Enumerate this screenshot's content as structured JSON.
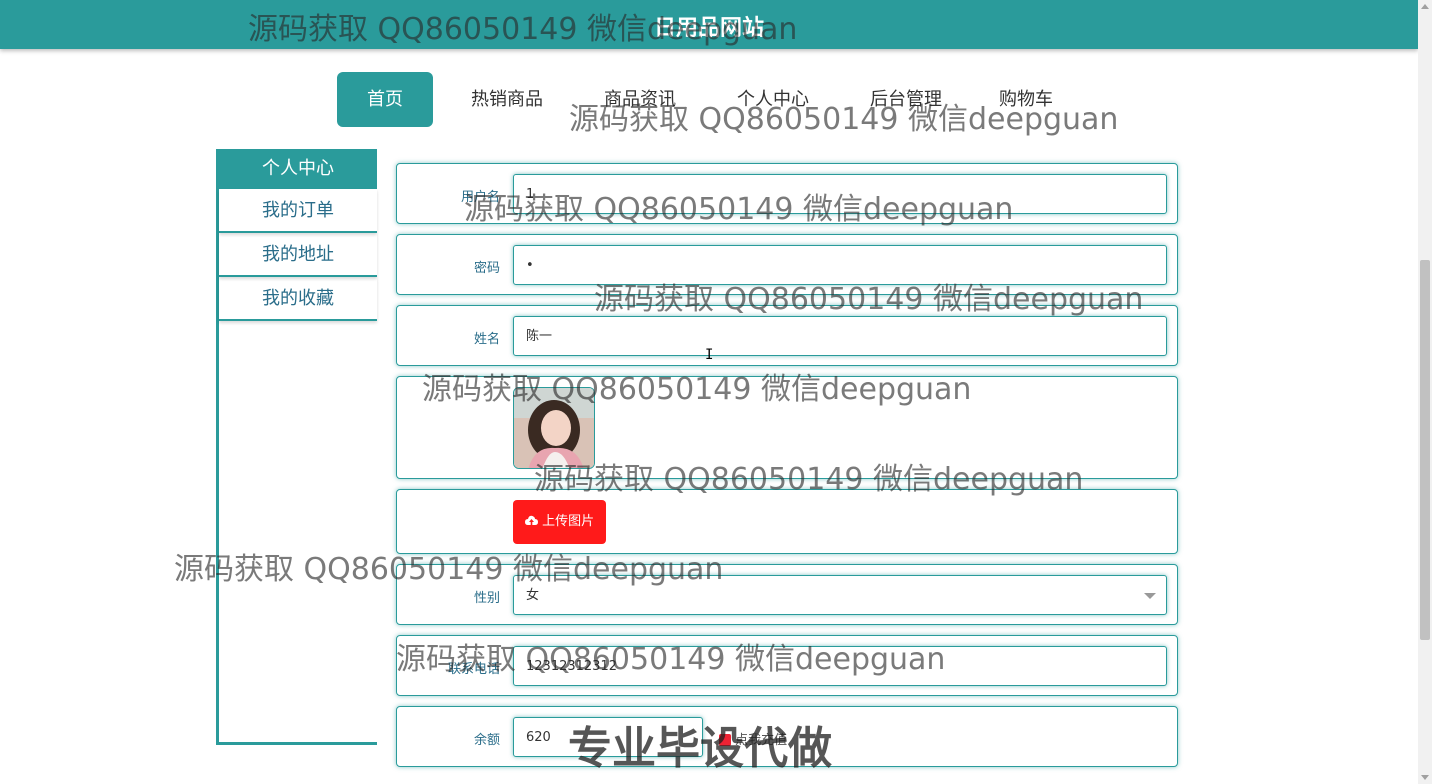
{
  "header": {
    "title": "日用品网站"
  },
  "nav": {
    "items": [
      "首页",
      "热销商品",
      "商品资讯",
      "个人中心",
      "后台管理",
      "购物车"
    ],
    "active_index": 0
  },
  "sidebar": {
    "title": "个人中心",
    "links": [
      "我的订单",
      "我的地址",
      "我的收藏"
    ]
  },
  "form": {
    "username": {
      "label": "用户名",
      "value": "1"
    },
    "password": {
      "label": "密码",
      "value": "•"
    },
    "name": {
      "label": "姓名",
      "value": "陈一"
    },
    "upload": {
      "label": "上传图片",
      "icon": "cloud-upload-icon"
    },
    "gender": {
      "label": "性别",
      "value": "女"
    },
    "phone": {
      "label": "联系电话",
      "value": "12312312312"
    },
    "balance": {
      "label": "余额",
      "value": "620",
      "recharge_label": "点我充值"
    }
  },
  "watermarks": {
    "text": "源码获取 QQ86050149 微信deepguan",
    "banner": "专业毕设代做"
  },
  "colors": {
    "primary": "#2a9b9b",
    "upload": "#ff1a1a",
    "link": "#2a6d8a"
  }
}
